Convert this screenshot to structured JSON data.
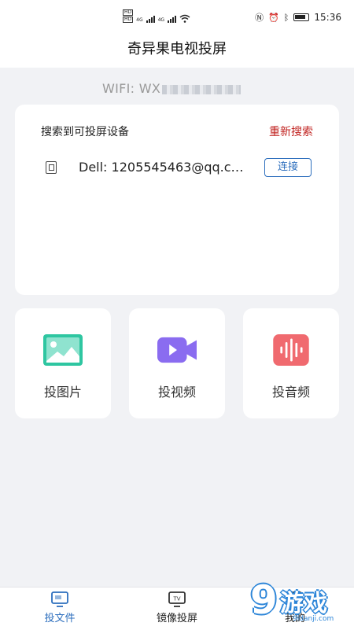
{
  "status_bar": {
    "sim1": "HD",
    "sim2": "HD",
    "net1": "4G",
    "net2": "4G",
    "time": "15:36"
  },
  "header": {
    "title": "奇异果电视投屏"
  },
  "wifi": {
    "prefix": "WIFI: WX"
  },
  "device_section": {
    "heading": "搜索到可投屏设备",
    "refresh_label": "重新搜索",
    "devices": [
      {
        "name": "Dell: 1205545463@qq.c…",
        "connect_label": "连接"
      }
    ]
  },
  "tiles": [
    {
      "label": "投图片",
      "icon": "image-icon",
      "color": "#2ec6a1"
    },
    {
      "label": "投视频",
      "icon": "video-icon",
      "color": "#8a6cf0"
    },
    {
      "label": "投音频",
      "icon": "audio-icon",
      "color": "#f06a6f"
    }
  ],
  "bottom_nav": [
    {
      "label": "投文件",
      "icon": "file-cast-icon",
      "active": true
    },
    {
      "label": "镜像投屏",
      "icon": "tv-icon",
      "active": false
    },
    {
      "label": "我的",
      "icon": "profile-icon",
      "active": false
    }
  ],
  "watermark": {
    "nine": "9",
    "text": "游戏",
    "url": "9ldanji.com"
  },
  "colors": {
    "accent": "#2c6ebd",
    "refresh": "#c0221f"
  }
}
